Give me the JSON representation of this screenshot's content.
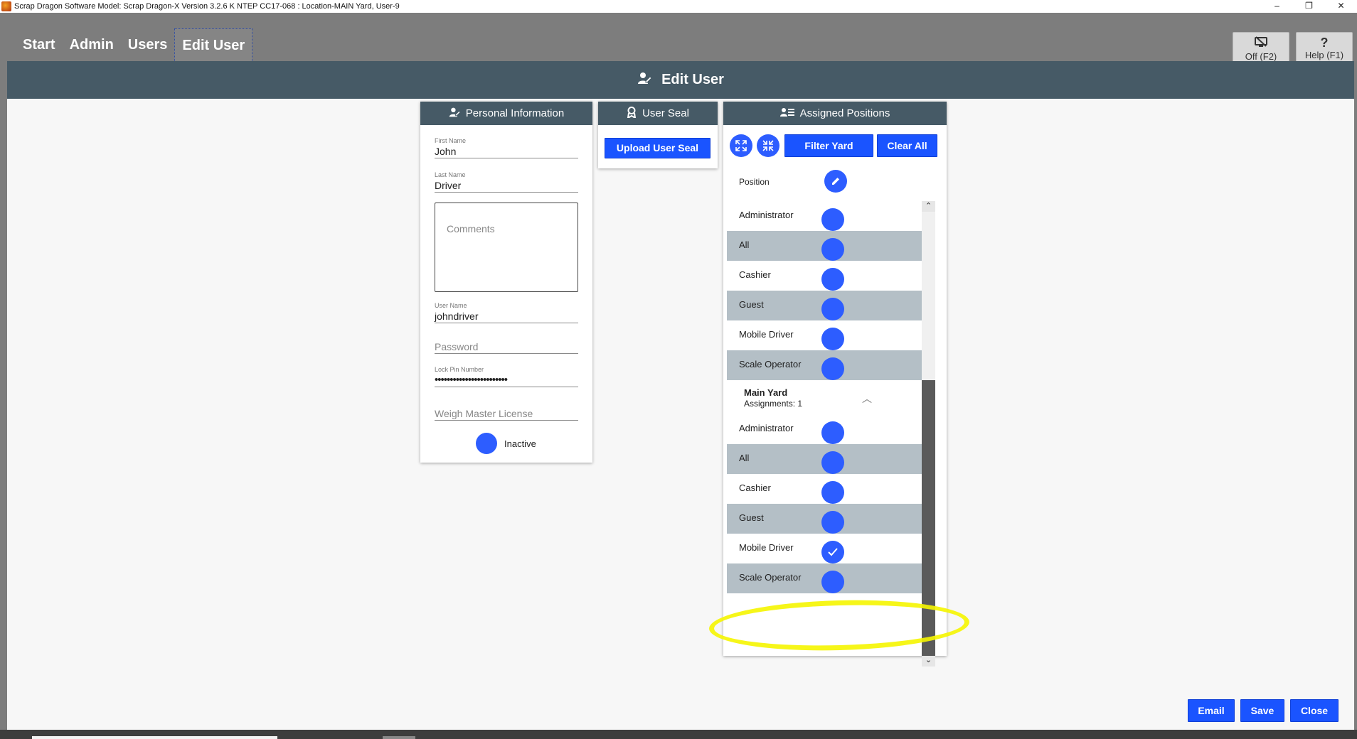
{
  "window": {
    "title": "Scrap Dragon Software Model: Scrap Dragon-X Version 3.2.6 K NTEP CC17-068 : Location-MAIN Yard, User-9",
    "controls": [
      "–",
      "❐",
      "✕"
    ]
  },
  "nav": {
    "items": [
      "Start",
      "Admin",
      "Users",
      "Edit User"
    ],
    "active": "Edit User"
  },
  "toolbar": {
    "off_label": "Off (F2)",
    "help_label": "Help (F1)"
  },
  "page": {
    "title": "Edit User"
  },
  "personal": {
    "header": "Personal Information",
    "first_name_label": "First Name",
    "first_name": "John",
    "last_name_label": "Last Name",
    "last_name": "Driver",
    "comments_placeholder": "Comments",
    "username_label": "User Name",
    "username": "johndriver",
    "password_placeholder": "Password",
    "lock_pin_label": "Lock Pin Number",
    "lock_pin": "••••••••••••••••••••••••",
    "license_placeholder": "Weigh Master License",
    "inactive_label": "Inactive"
  },
  "seal": {
    "header": "User Seal",
    "upload_label": "Upload User Seal"
  },
  "positions": {
    "header": "Assigned Positions",
    "filter_label": "Filter Yard",
    "clear_label": "Clear All",
    "position_label": "Position",
    "group1": [
      "Administrator",
      "All",
      "Cashier",
      "Guest",
      "Mobile Driver",
      "Scale Operator"
    ],
    "group2_title": "Main Yard",
    "group2_assignments": "Assignments: 1",
    "group2": [
      "Administrator",
      "All",
      "Cashier",
      "Guest",
      "Mobile Driver",
      "Scale Operator"
    ],
    "checked": "Mobile Driver"
  },
  "footer": {
    "email_label": "Email",
    "save_label": "Save",
    "close_label": "Close"
  },
  "colors": {
    "accent": "#1a54ff",
    "header": "#465a66",
    "highlight": "#f5f500"
  }
}
